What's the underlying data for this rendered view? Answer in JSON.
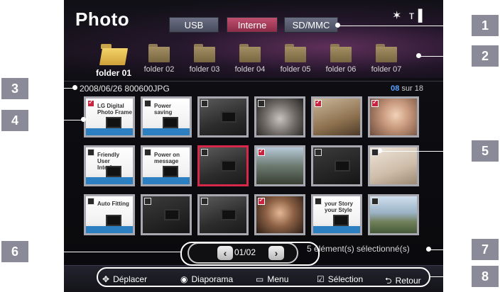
{
  "app": {
    "title": "Photo"
  },
  "sources": [
    {
      "label": "USB",
      "active": false
    },
    {
      "label": "Interne",
      "active": true
    },
    {
      "label": "SD/MMC",
      "active": false
    }
  ],
  "status_icons": [
    "bluetooth-icon",
    "signal-icon"
  ],
  "folders": [
    {
      "label": "folder 01",
      "open": true
    },
    {
      "label": "folder 02",
      "open": false
    },
    {
      "label": "folder 03",
      "open": false
    },
    {
      "label": "folder 04",
      "open": false
    },
    {
      "label": "folder 05",
      "open": false
    },
    {
      "label": "folder 06",
      "open": false
    },
    {
      "label": "folder 07",
      "open": false
    }
  ],
  "info": {
    "file_name": "2008/06/26 800600JPG",
    "current_index": "08",
    "total_label": "sur 18"
  },
  "thumbnails": [
    {
      "checked": true,
      "art": "product",
      "caption": "LG Digital Photo Frame"
    },
    {
      "checked": false,
      "art": "product",
      "caption": "Power saving"
    },
    {
      "checked": false,
      "art": "desk"
    },
    {
      "checked": false,
      "art": "hands"
    },
    {
      "checked": true,
      "art": "room"
    },
    {
      "checked": true,
      "art": "face"
    },
    {
      "checked": false,
      "art": "product",
      "caption": "Friendly User Interface"
    },
    {
      "checked": false,
      "art": "product",
      "caption": "Power on message"
    },
    {
      "checked": false,
      "art": "desk",
      "focused": true
    },
    {
      "checked": true,
      "art": "street"
    },
    {
      "checked": false,
      "art": "dark"
    },
    {
      "checked": false,
      "art": "bed"
    },
    {
      "checked": false,
      "art": "product",
      "caption": "Auto Fitting"
    },
    {
      "checked": false,
      "art": "dark"
    },
    {
      "checked": false,
      "art": "desk"
    },
    {
      "checked": true,
      "art": "couple"
    },
    {
      "checked": false,
      "art": "product",
      "caption": "your Story your Style"
    },
    {
      "checked": false,
      "art": "castle"
    }
  ],
  "pager": {
    "prev": "‹",
    "next": "›",
    "text": "01/02"
  },
  "selected_text": "5 élément(s) sélectionné(s)",
  "hints": [
    {
      "icon": "move-arrows-icon",
      "glyph": "✥",
      "label": "Déplacer"
    },
    {
      "icon": "ok-button-icon",
      "glyph": "◉",
      "label": "Diaporama"
    },
    {
      "icon": "menu-icon",
      "glyph": "▭",
      "label": "Menu"
    },
    {
      "icon": "checkbox-icon",
      "glyph": "☑",
      "label": "Sélection"
    },
    {
      "icon": "return-icon",
      "glyph": "⮌",
      "label": "Retour"
    }
  ],
  "callouts": [
    "1",
    "2",
    "3",
    "4",
    "5",
    "6",
    "7",
    "8"
  ],
  "colors": {
    "active_tab": "#a8385a",
    "focus_border": "#d8284a",
    "index_highlight": "#5aa0ff",
    "callout_box": "#8a8a98"
  }
}
